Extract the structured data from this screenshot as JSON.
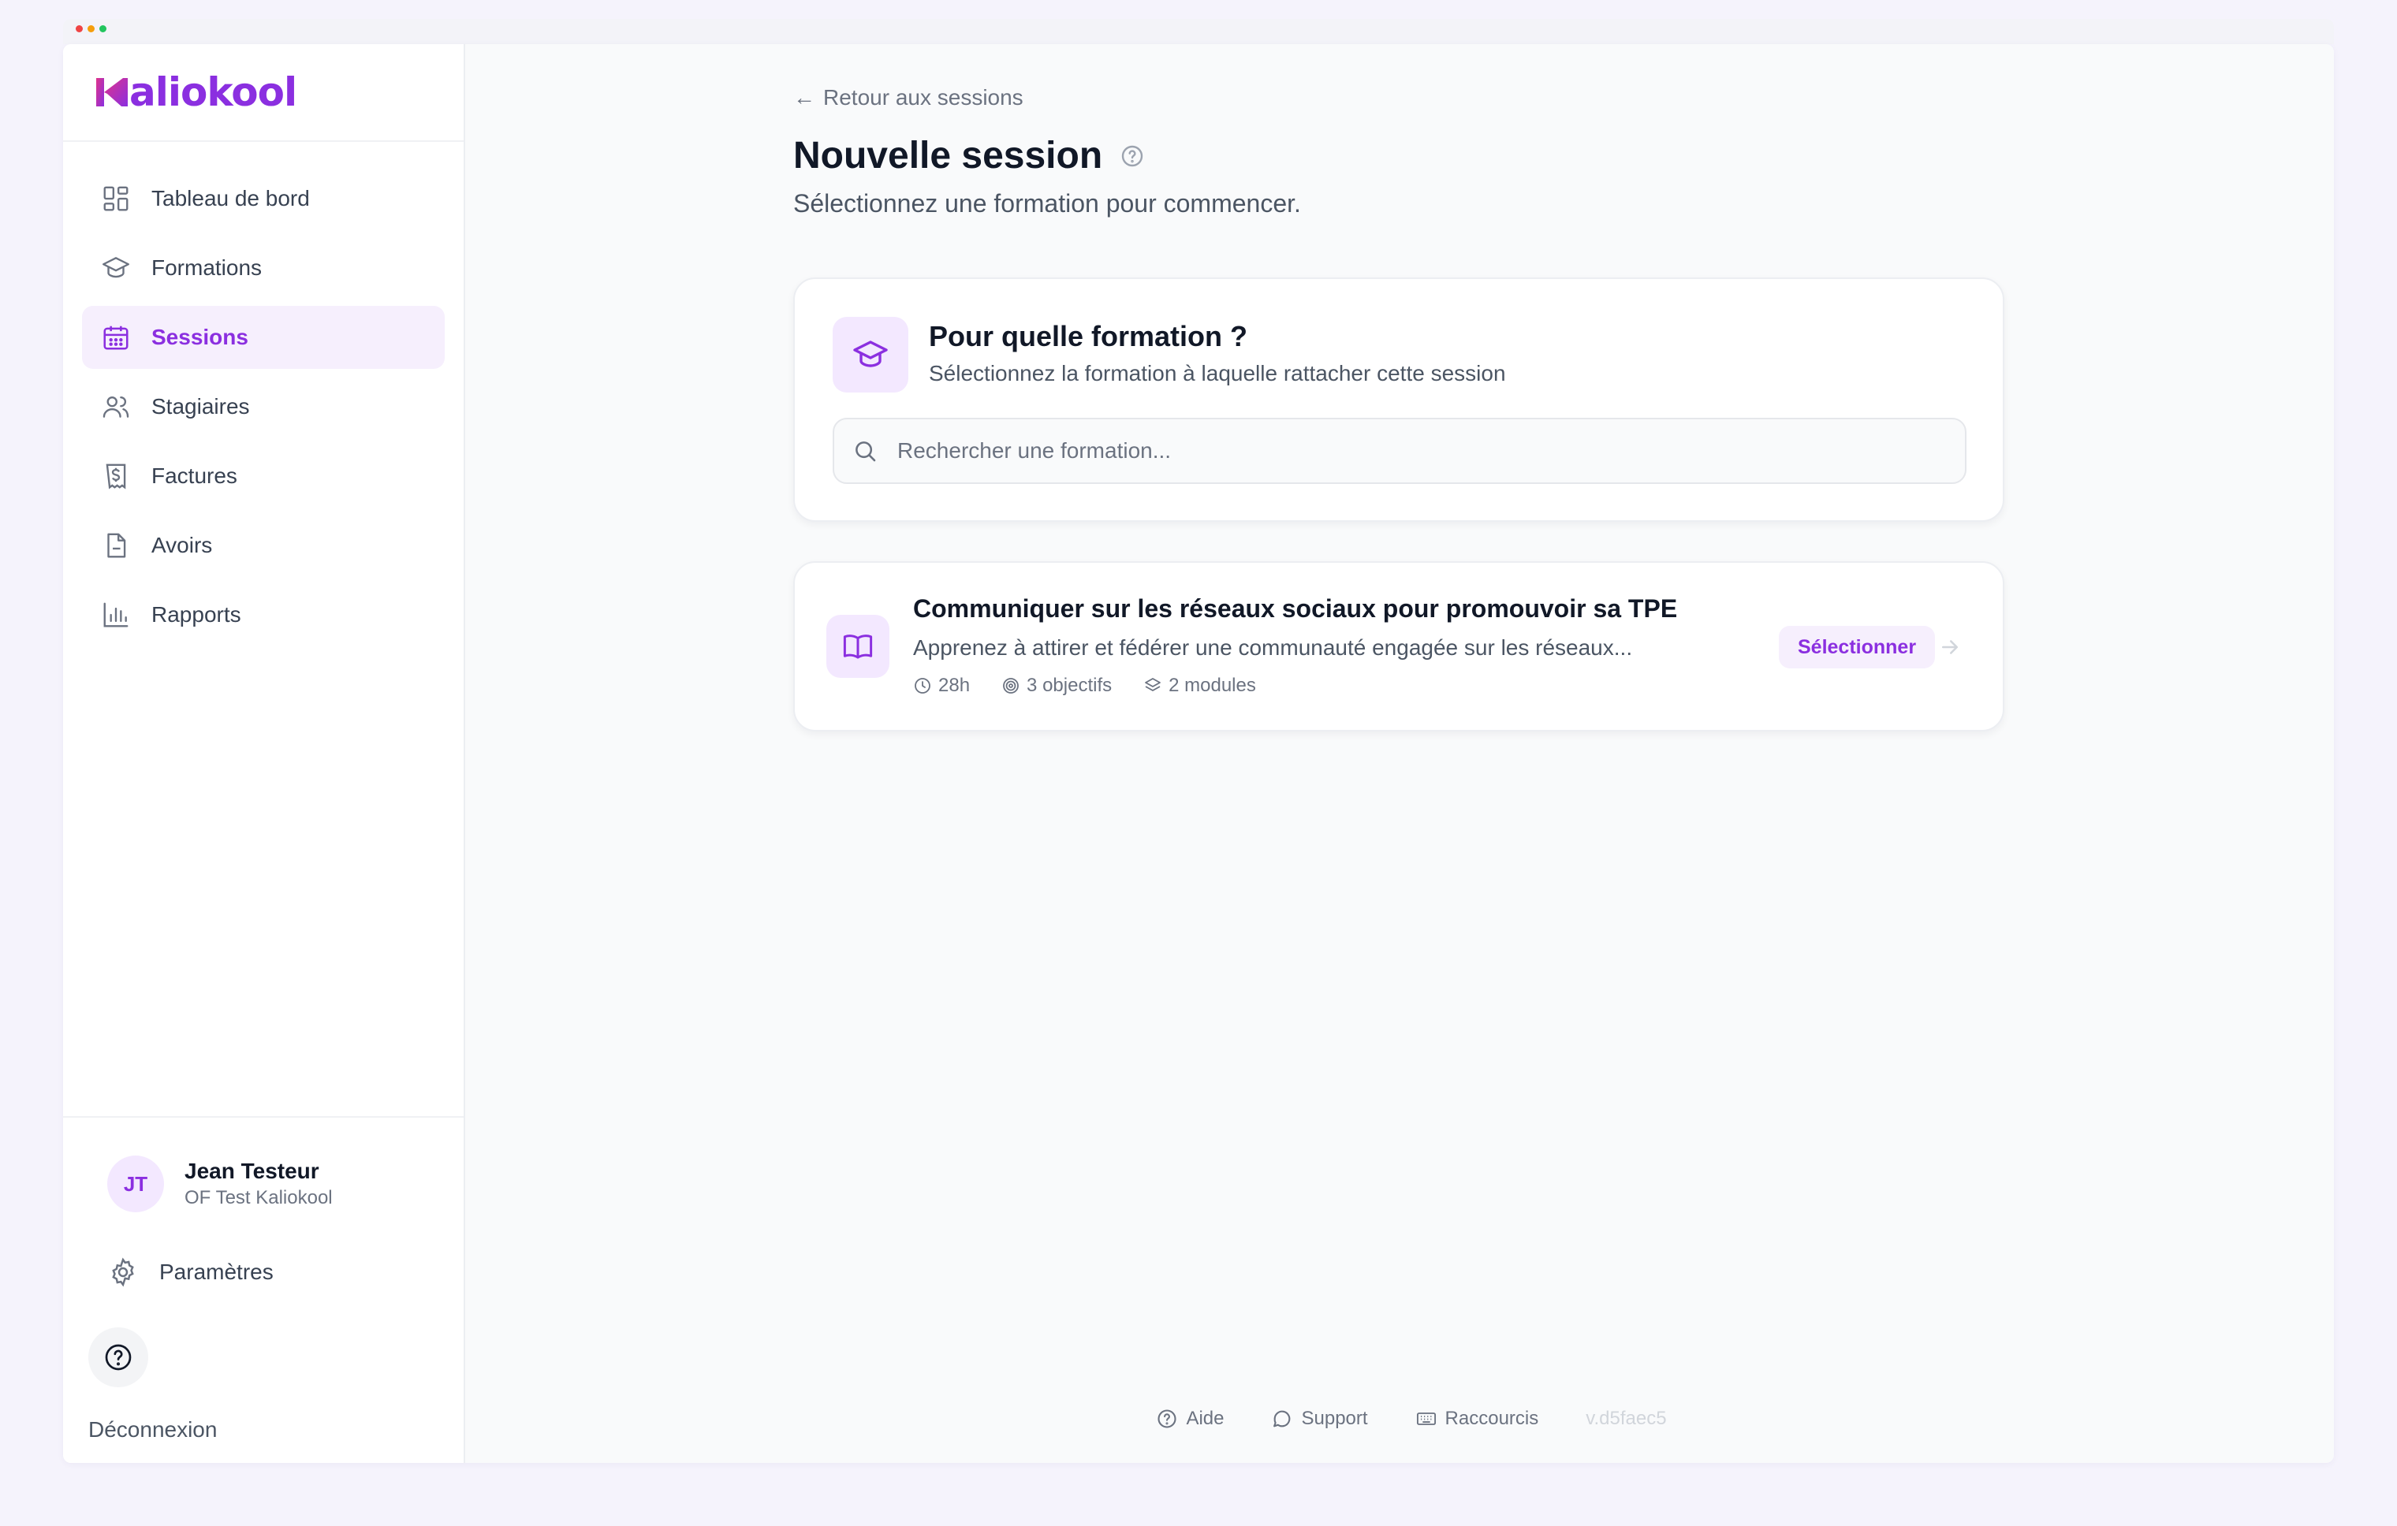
{
  "app": {
    "brand": "Kaliokool",
    "logo_letter": "K",
    "logo_rest": "aliokool",
    "accent_color": "#8b2fe0",
    "window_dots": [
      "#ef4444",
      "#f59e0b",
      "#22c55e"
    ]
  },
  "sidebar": {
    "items": [
      {
        "label": "Tableau de bord",
        "icon": "dashboard-icon",
        "active": false
      },
      {
        "label": "Formations",
        "icon": "graduation-cap-icon",
        "active": false
      },
      {
        "label": "Sessions",
        "icon": "calendar-icon",
        "active": true
      },
      {
        "label": "Stagiaires",
        "icon": "users-icon",
        "active": false
      },
      {
        "label": "Factures",
        "icon": "receipt-dollar-icon",
        "active": false
      },
      {
        "label": "Avoirs",
        "icon": "file-minus-icon",
        "active": false
      },
      {
        "label": "Rapports",
        "icon": "bar-chart-icon",
        "active": false
      }
    ],
    "user": {
      "initials": "JT",
      "name": "Jean Testeur",
      "org": "OF Test Kaliokool"
    },
    "settings_label": "Paramètres",
    "logout_label": "Déconnexion"
  },
  "main": {
    "back_label": "Retour aux sessions",
    "title": "Nouvelle session",
    "subtitle": "Sélectionnez une formation pour commencer.",
    "picker": {
      "title": "Pour quelle formation ?",
      "subtitle": "Sélectionnez la formation à laquelle rattacher cette session",
      "search_placeholder": "Rechercher une formation..."
    },
    "formation": {
      "title": "Communiquer sur les réseaux sociaux pour promouvoir sa TPE",
      "description": "Apprenez à attirer et fédérer une communauté engagée sur les réseaux...",
      "duration": "28h",
      "objectives": "3 objectifs",
      "modules": "2 modules",
      "select_label": "Sélectionner"
    }
  },
  "footer": {
    "help": "Aide",
    "support": "Support",
    "shortcuts": "Raccourcis",
    "version": "v.d5faec5"
  }
}
